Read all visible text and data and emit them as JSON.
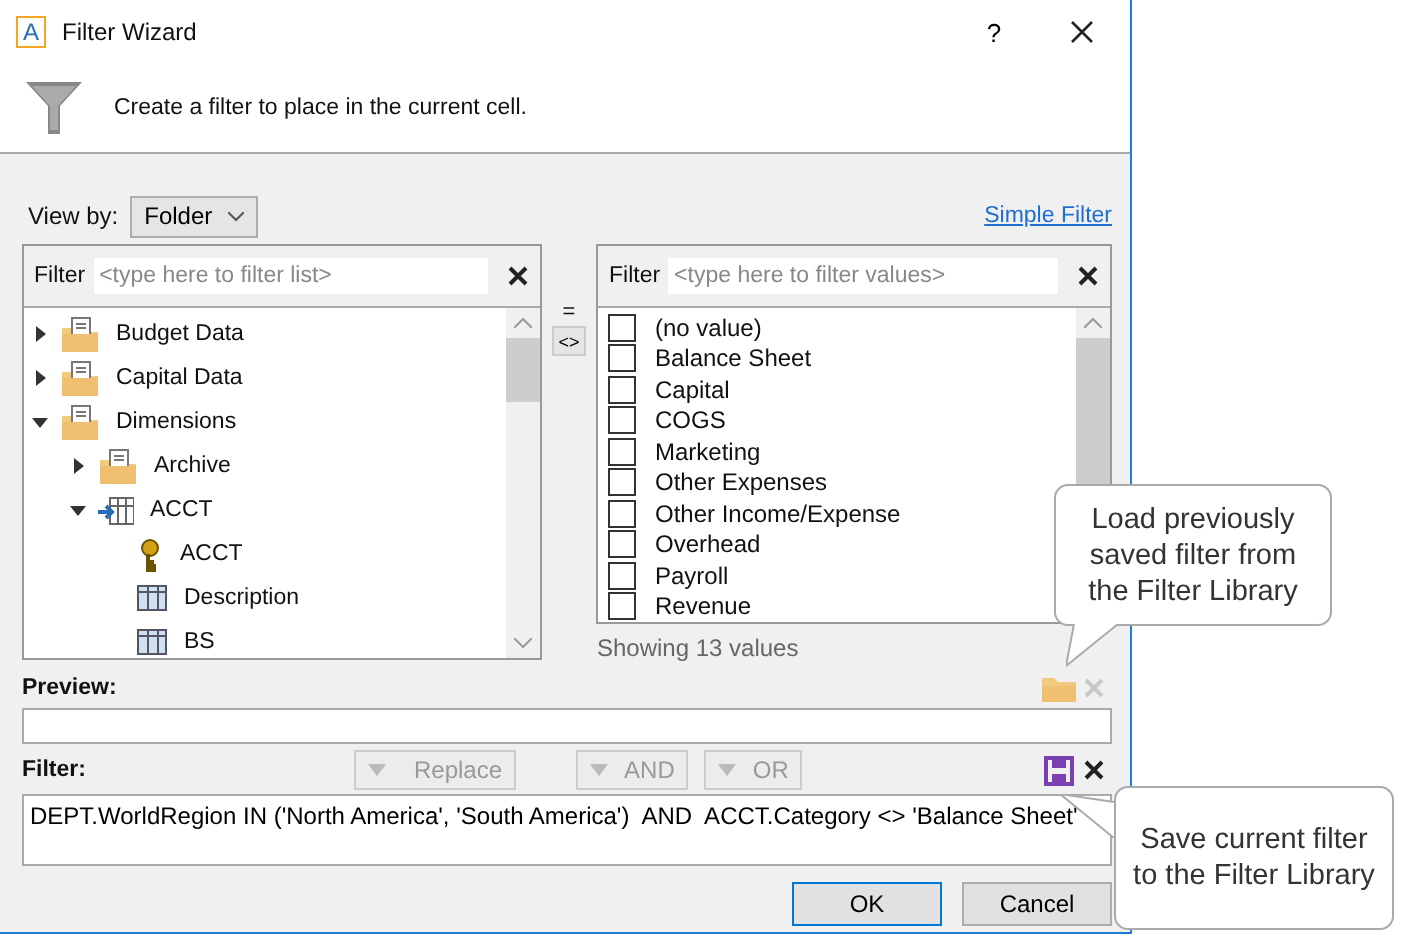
{
  "window": {
    "app_icon": "A",
    "title": "Filter Wizard",
    "help": "?"
  },
  "header": {
    "text": "Create a filter to place in the current cell."
  },
  "view_by": {
    "label": "View by:",
    "value": "Folder"
  },
  "simple_filter_link": "Simple Filter",
  "list_panel": {
    "filter_label": "Filter",
    "placeholder": "<type here to filter list>",
    "tree": [
      {
        "label": "Budget Data",
        "kind": "folder",
        "expanded": false
      },
      {
        "label": "Capital Data",
        "kind": "folder",
        "expanded": false
      },
      {
        "label": "Dimensions",
        "kind": "folder",
        "expanded": true,
        "children": [
          {
            "label": "Archive",
            "kind": "folder",
            "expanded": false
          },
          {
            "label": "ACCT",
            "kind": "table",
            "expanded": true,
            "children": [
              {
                "label": "ACCT",
                "kind": "key"
              },
              {
                "label": "Description",
                "kind": "column"
              },
              {
                "label": "BS",
                "kind": "column"
              }
            ]
          }
        ]
      }
    ]
  },
  "operators": [
    {
      "label": "=",
      "kind": "plain"
    },
    {
      "label": "<>",
      "kind": "button"
    }
  ],
  "values_panel": {
    "filter_label": "Filter",
    "placeholder": "<type here to filter values>",
    "values": [
      {
        "label": "(no value)",
        "checked": false
      },
      {
        "label": "Balance Sheet",
        "checked": false
      },
      {
        "label": "Capital",
        "checked": false
      },
      {
        "label": "COGS",
        "checked": false
      },
      {
        "label": "Marketing",
        "checked": false
      },
      {
        "label": "Other Expenses",
        "checked": false
      },
      {
        "label": "Other Income/Expense",
        "checked": false
      },
      {
        "label": "Overhead",
        "checked": false
      },
      {
        "label": "Payroll",
        "checked": false
      },
      {
        "label": "Revenue",
        "checked": false
      }
    ],
    "count": "Showing 13 values"
  },
  "preview": {
    "label": "Preview:"
  },
  "filter": {
    "label": "Filter:",
    "buttons": [
      {
        "label": "Replace",
        "disabled": true
      },
      {
        "label": "AND",
        "disabled": true
      },
      {
        "label": "OR",
        "disabled": true
      }
    ],
    "value": "DEPT.WorldRegion IN ('North America', 'South America')  AND  ACCT.Category <> 'Balance Sheet'"
  },
  "buttons": [
    {
      "label": "OK",
      "default": true
    },
    {
      "label": "Cancel",
      "default": false
    }
  ],
  "callouts": [
    {
      "text": "Load previously saved filter from the Filter Library",
      "kind": "below"
    },
    {
      "text": "Save current filter to the Filter Library",
      "kind": "left"
    }
  ]
}
